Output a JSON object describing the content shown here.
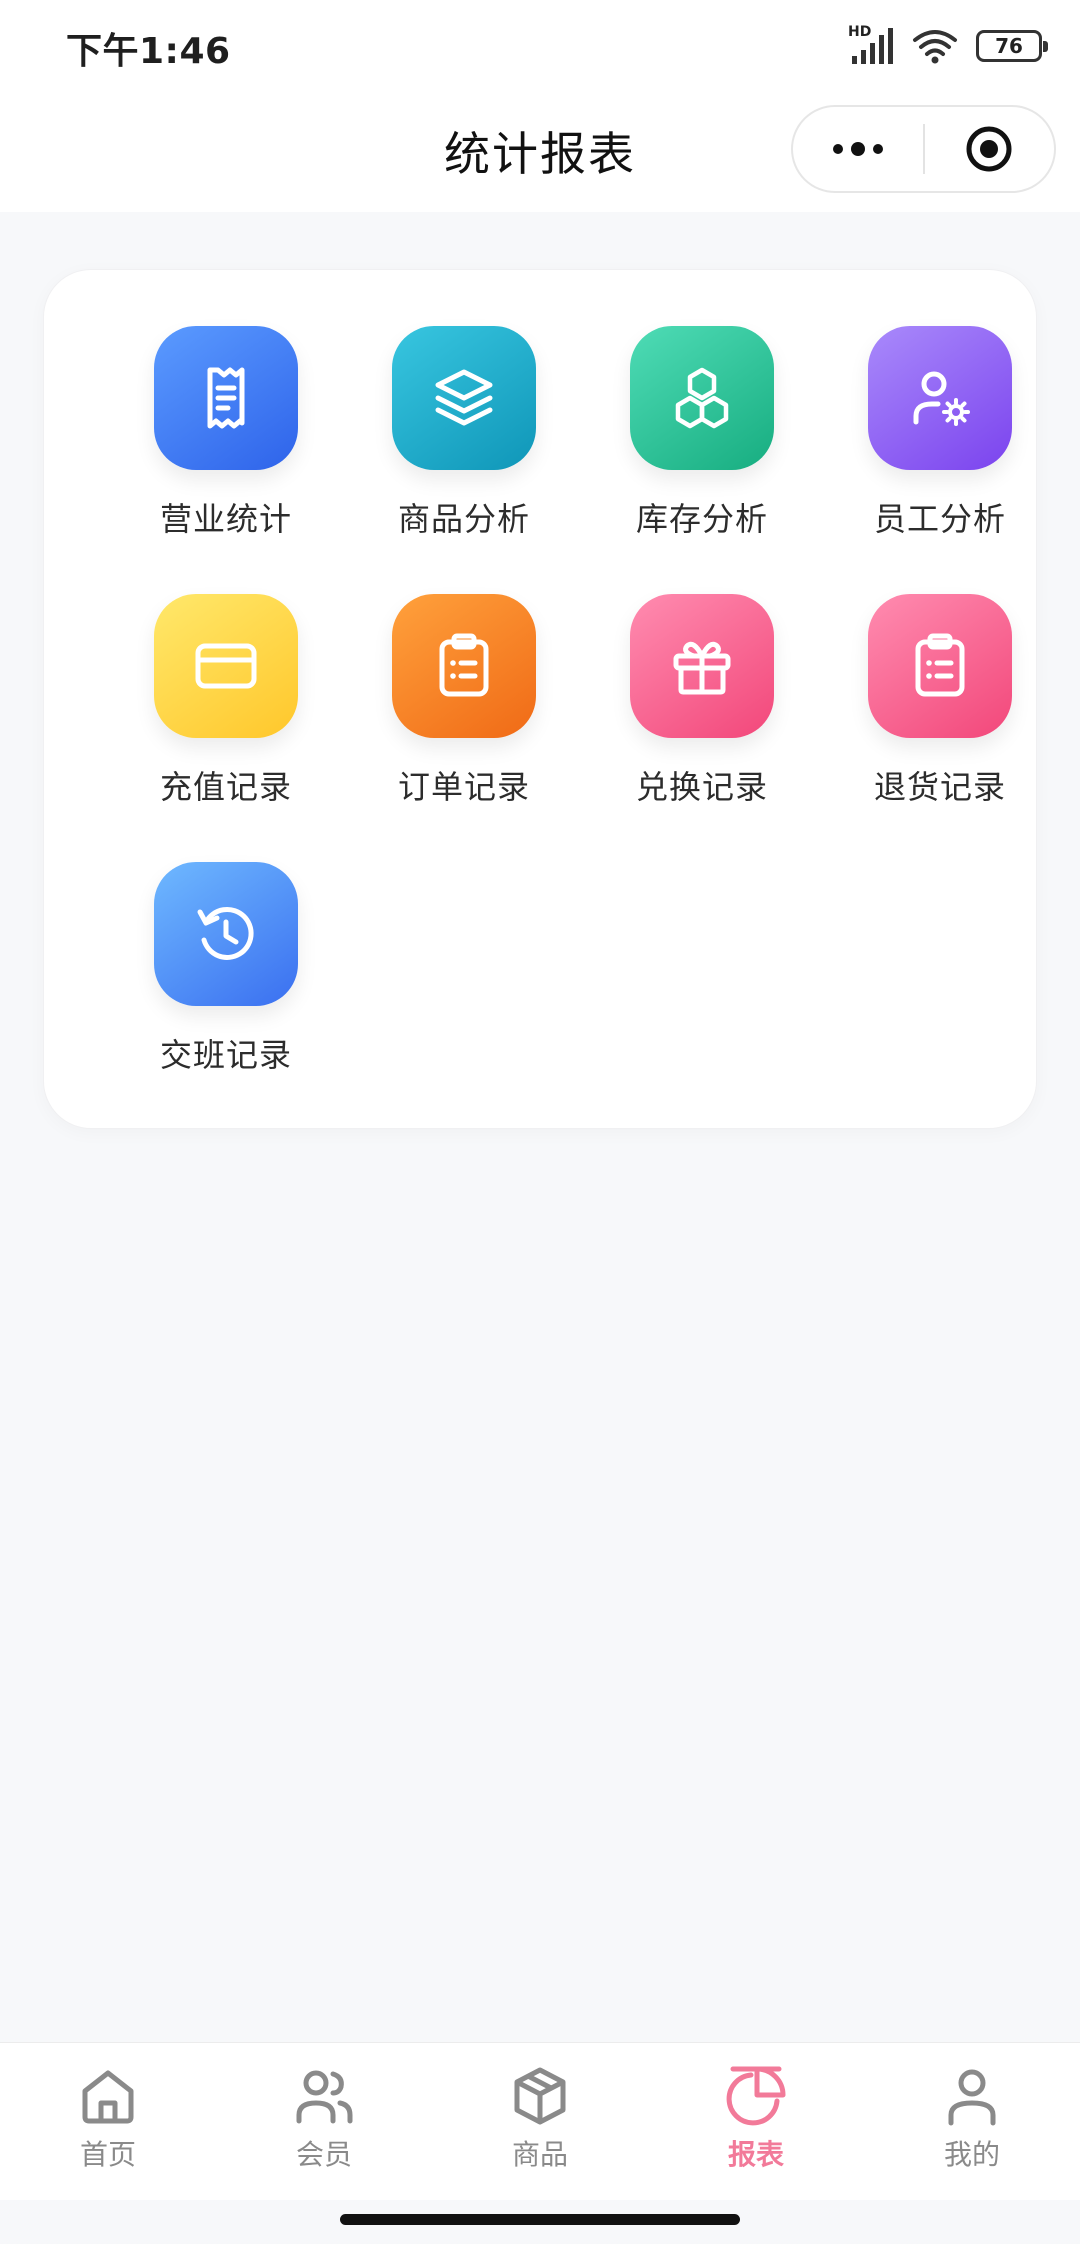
{
  "status_bar": {
    "time": "下午1:46",
    "network": "HD",
    "battery": "76"
  },
  "header": {
    "title": "统计报表"
  },
  "colors": {
    "active_tab": "#f27a99",
    "inactive_tab": "#8a8a8a"
  },
  "menu": [
    {
      "label": "营业统计",
      "icon": "receipt-icon"
    },
    {
      "label": "商品分析",
      "icon": "layers-icon"
    },
    {
      "label": "库存分析",
      "icon": "boxes-icon"
    },
    {
      "label": "员工分析",
      "icon": "user-settings-icon"
    },
    {
      "label": "充值记录",
      "icon": "credit-card-icon"
    },
    {
      "label": "订单记录",
      "icon": "clipboard-list-icon"
    },
    {
      "label": "兑换记录",
      "icon": "gift-icon"
    },
    {
      "label": "退货记录",
      "icon": "clipboard-list-icon"
    },
    {
      "label": "交班记录",
      "icon": "history-icon"
    }
  ],
  "tabs": [
    {
      "label": "首页",
      "icon": "home-icon"
    },
    {
      "label": "会员",
      "icon": "users-icon"
    },
    {
      "label": "商品",
      "icon": "package-icon"
    },
    {
      "label": "报表",
      "icon": "pie-chart-icon",
      "active": true
    },
    {
      "label": "我的",
      "icon": "user-icon"
    }
  ]
}
